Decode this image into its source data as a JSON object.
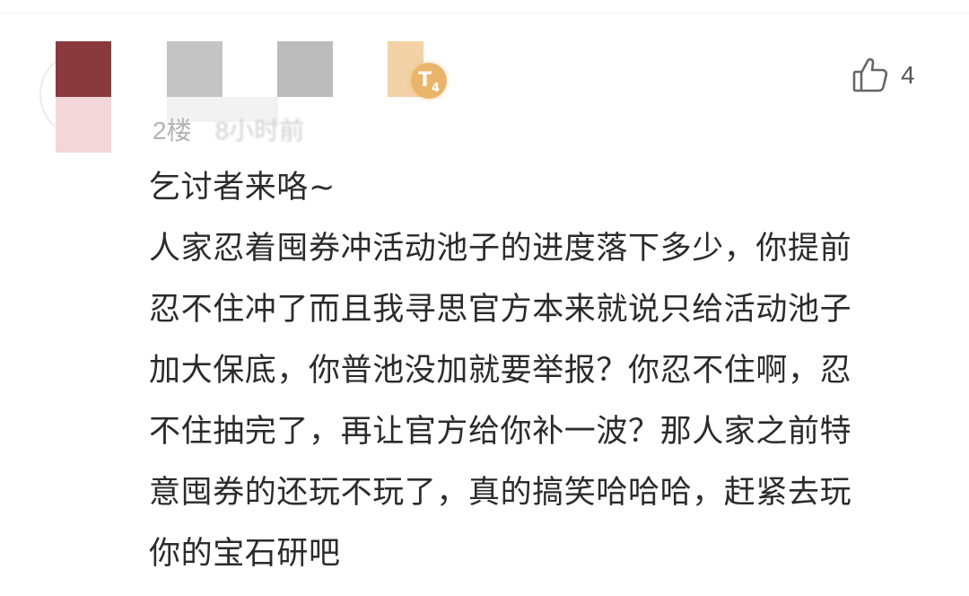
{
  "like": {
    "icon": "thumbs-up-icon",
    "count": "4"
  },
  "level_badge": {
    "letter": "T",
    "level": "4",
    "color": "#e8b56a"
  },
  "meta": {
    "floor": "2楼",
    "time": "8小时前"
  },
  "comment": {
    "lines": [
      "乞讨者来咯~",
      "人家忍着囤券冲活动池子的进度落下多少，你提前",
      "忍不住冲了而且我寻思官方本来就说只给活动池子",
      "加大保底，你普池没加就要举报？你忍不住啊，忍",
      "不住抽完了，再让官方给你补一波？那人家之前特",
      "意囤券的还玩不玩了，真的搞笑哈哈哈，赶紧去玩",
      "你的宝石研吧"
    ]
  }
}
